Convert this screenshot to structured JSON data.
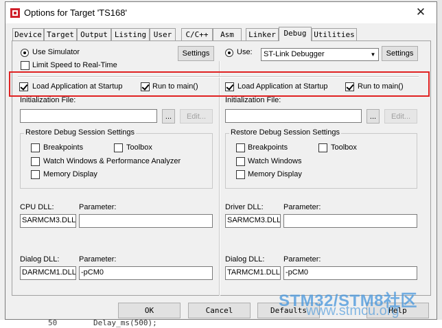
{
  "window": {
    "title": "Options for Target 'TS168'",
    "close_glyph": "✕"
  },
  "tabs": [
    "Device",
    "Target",
    "Output",
    "Listing",
    "User",
    "C/C++",
    "Asm",
    "Linker",
    "Debug",
    "Utilities"
  ],
  "active_tab": "Debug",
  "left": {
    "use_simulator_label": "Use Simulator",
    "use_simulator_selected": true,
    "settings_label": "Settings",
    "limit_speed_label": "Limit Speed to Real-Time",
    "limit_speed_checked": false,
    "load_app_label": "Load Application at Startup",
    "load_app_checked": true,
    "run_to_main_label": "Run to main()",
    "run_to_main_checked": true,
    "init_file_label": "Initialization File:",
    "init_file_value": "",
    "browse_label": "...",
    "edit_label": "Edit...",
    "restore_title": "Restore Debug Session Settings",
    "breakpoints_label": "Breakpoints",
    "toolbox_label": "Toolbox",
    "watch_label": "Watch Windows & Performance Analyzer",
    "memory_label": "Memory Display",
    "dll_label": "CPU DLL:",
    "dll_param_label": "Parameter:",
    "dll_value": "SARMCM3.DLL",
    "dll_param_value": "",
    "dialog_dll_label": "Dialog DLL:",
    "dialog_param_label": "Parameter:",
    "dialog_dll_value": "DARMCM1.DLL",
    "dialog_param_value": "-pCM0"
  },
  "right": {
    "use_label": "Use:",
    "use_selected": true,
    "debugger_value": "ST-Link Debugger",
    "settings_label": "Settings",
    "load_app_label": "Load Application at Startup",
    "load_app_checked": true,
    "run_to_main_label": "Run to main()",
    "run_to_main_checked": true,
    "init_file_label": "Initialization File:",
    "init_file_value": "",
    "browse_label": "...",
    "edit_label": "Edit...",
    "restore_title": "Restore Debug Session Settings",
    "breakpoints_label": "Breakpoints",
    "toolbox_label": "Toolbox",
    "watch_label": "Watch Windows",
    "memory_label": "Memory Display",
    "dll_label": "Driver DLL:",
    "dll_param_label": "Parameter:",
    "dll_value": "SARMCM3.DLL",
    "dll_param_value": "",
    "dialog_dll_label": "Dialog DLL:",
    "dialog_param_label": "Parameter:",
    "dialog_dll_value": "TARMCM1.DLL",
    "dialog_param_value": "-pCM0"
  },
  "buttons": {
    "ok": "OK",
    "cancel": "Cancel",
    "defaults": "Defaults",
    "help": "Help"
  },
  "editor": {
    "line_number": "50",
    "code": "Delay_ms(500);"
  },
  "watermark": {
    "title": "STM32/STM8社区",
    "url": "www.stmcu.org"
  },
  "colors": {
    "highlight": "#e02020",
    "watermark": "#4696dc"
  }
}
